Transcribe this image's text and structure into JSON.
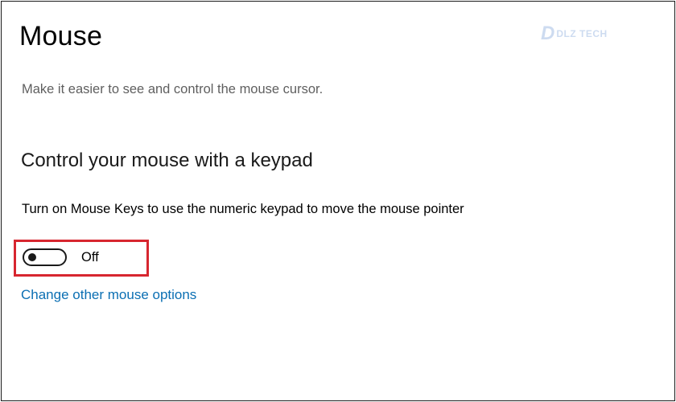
{
  "page": {
    "title": "Mouse",
    "subtitle": "Make it easier to see and control the mouse cursor."
  },
  "section": {
    "title": "Control your mouse with a keypad",
    "description": "Turn on Mouse Keys to use the numeric keypad to move the mouse pointer",
    "toggle": {
      "state_label": "Off",
      "checked": false
    },
    "link_label": "Change other mouse options"
  },
  "watermark": {
    "text": "DLZ TECH"
  },
  "colors": {
    "link": "#0b6fb3",
    "highlight": "#d7262f",
    "subtitle": "#5f5f5f"
  }
}
